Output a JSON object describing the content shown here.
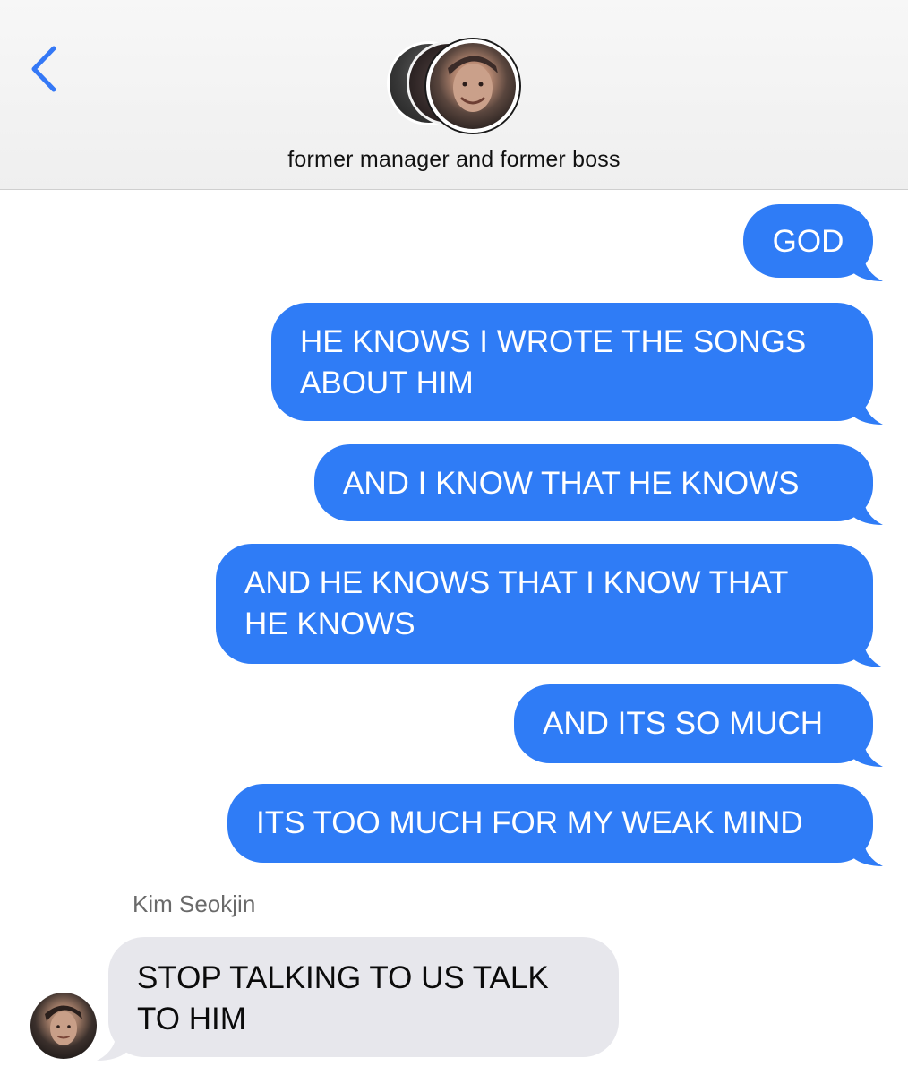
{
  "header": {
    "title": "former manager and former boss",
    "back_icon": "chevron-left-icon",
    "accent_color": "#3478f6"
  },
  "messages": [
    {
      "direction": "outgoing",
      "text_lines": [
        "GOD"
      ]
    },
    {
      "direction": "outgoing",
      "text_lines": [
        "HE KNOWS I WROTE THE SONGS",
        "ABOUT HIM"
      ]
    },
    {
      "direction": "outgoing",
      "text_lines": [
        "AND I KNOW THAT HE KNOWS"
      ]
    },
    {
      "direction": "outgoing",
      "text_lines": [
        "AND HE KNOWS THAT I KNOW THAT",
        "HE KNOWS"
      ]
    },
    {
      "direction": "outgoing",
      "text_lines": [
        "AND ITS SO MUCH"
      ]
    },
    {
      "direction": "outgoing",
      "text_lines": [
        "ITS TOO MUCH FOR MY WEAK MIND"
      ]
    }
  ],
  "incoming": {
    "sender": "Kim Seokjin",
    "text_lines": [
      "STOP TALKING TO US TALK",
      "TO HIM"
    ]
  },
  "colors": {
    "outgoing_bubble": "#2f7cf6",
    "incoming_bubble": "#e7e7ec"
  }
}
